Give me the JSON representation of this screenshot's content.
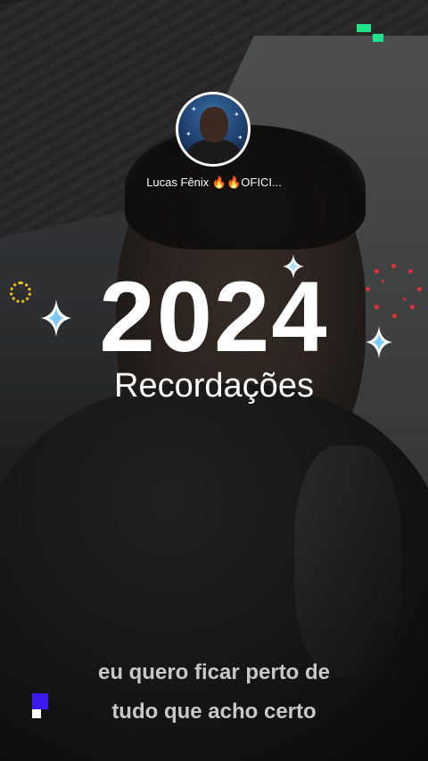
{
  "profile": {
    "username": "Lucas Fênix 🔥🔥OFICI..."
  },
  "title": {
    "year": "2024",
    "subtitle": "Recordações"
  },
  "caption": {
    "line1": "eu quero ficar perto de",
    "line2": "tudo que acho certo"
  },
  "colors": {
    "corner_mark": "#23e08a",
    "gear": "#f2c21b",
    "fireworks": "#e0323a",
    "logo": "#3b1bf0"
  },
  "icons": [
    "sparkle-icon",
    "gear-icon",
    "fireworks-icon",
    "corner-mark-icon",
    "logo-mark-icon"
  ]
}
